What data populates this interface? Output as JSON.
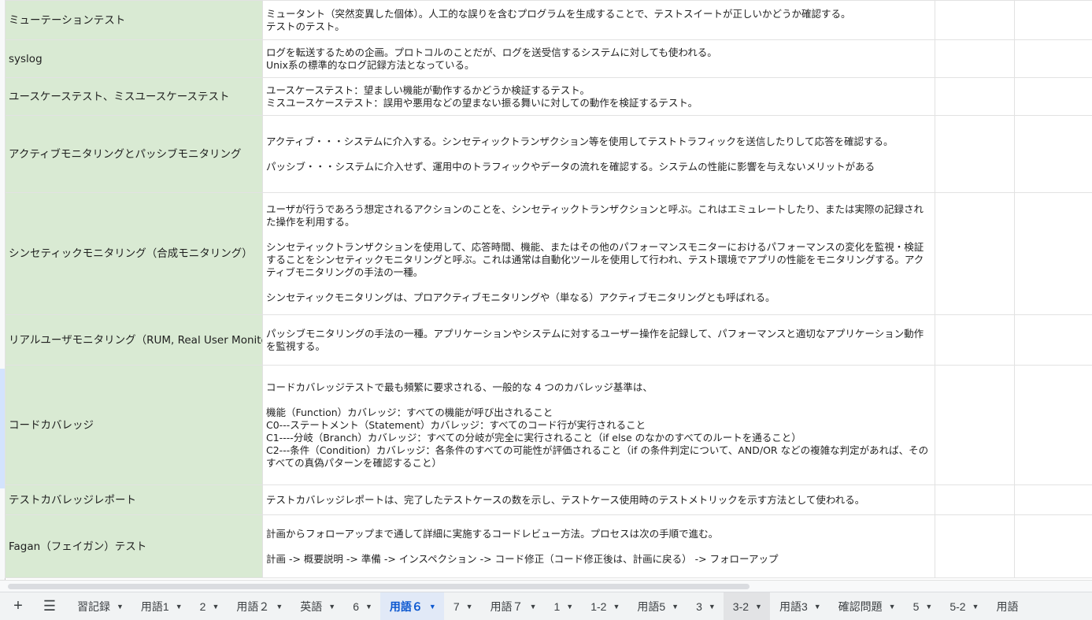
{
  "rows": [
    {
      "term": "ミューテーションテスト",
      "desc": [
        "ミュータント（突然変異した個体）。人工的な誤りを含むプログラムを生成することで、テストスイートが正しいかどうか確認する。",
        "テストのテスト。"
      ]
    },
    {
      "term": "syslog",
      "desc": [
        "ログを転送するための企画。プロトコルのことだが、ログを送受信するシステムに対しても使われる。",
        "Unix系の標準的なログ記録方法となっている。"
      ]
    },
    {
      "term": "ユースケーステスト、ミスユースケーステスト",
      "desc": [
        "ユースケーステスト：望ましい機能が動作するかどうか検証するテスト。",
        "ミスユースケーステスト：誤用や悪用などの望まない振る舞いに対しての動作を検証するテスト。"
      ]
    },
    {
      "term": "アクティブモニタリングとパッシブモニタリング",
      "desc": [
        "アクティブ・・・システムに介入する。シンセティックトランザクション等を使用してテストトラフィックを送信したりして応答を確認する。",
        "",
        "パッシブ・・・システムに介入せず、運用中のトラフィックやデータの流れを確認する。システムの性能に影響を与えないメリットがある"
      ]
    },
    {
      "term": "シンセティックモニタリング（合成モニタリング）",
      "desc": [
        "ユーザが行うであろう想定されるアクションのことを、シンセティックトランザクションと呼ぶ。これはエミュレートしたり、または実際の記録された操作を利用する。",
        "",
        "シンセティックトランザクションを使用して、応答時間、機能、またはその他のパフォーマンスモニターにおけるパフォーマンスの変化を監視・検証することをシンセティックモニタリングと呼ぶ。これは通常は自動化ツールを使用して行われ、テスト環境でアプリの性能をモニタリングする。アクティブモニタリングの手法の一種。",
        "",
        "シンセティックモニタリングは、プロアクティブモニタリングや（単なる）アクティブモニタリングとも呼ばれる。"
      ]
    },
    {
      "term": "リアルユーザモニタリング（RUM, Real User Monitoring）",
      "desc": [
        "パッシブモニタリングの手法の一種。アプリケーションやシステムに対するユーザー操作を記録して、パフォーマンスと適切なアプリケーション動作を監視する。"
      ]
    },
    {
      "term": "コードカバレッジ",
      "desc": [
        "コードカバレッジテストで最も頻繁に要求される、一般的な 4 つのカバレッジ基準は、",
        "",
        "機能（Function）カバレッジ：すべての機能が呼び出されること",
        "C0---ステートメント（Statement）カバレッジ：すべてのコード行が実行されること",
        "C1----分岐（Branch）カバレッジ：すべての分岐が完全に実行されること（if else のなかのすべてのルートを通ること）",
        "C2---条件（Condition）カバレッジ：各条件のすべての可能性が評価されること（if の条件判定について、AND/OR などの複雑な判定があれば、そのすべての真偽パターンを確認すること）"
      ]
    },
    {
      "term": "テストカバレッジレポート",
      "desc": [
        "テストカバレッジレポートは、完了したテストケースの数を示し、テストケース使用時のテストメトリックを示す方法として使われる。"
      ]
    },
    {
      "term": "Fagan（フェイガン）テスト",
      "desc": [
        "計画からフォローアップまで通して詳細に実施するコードレビュー方法。プロセスは次の手順で進む。",
        "",
        "計画 -> 概要説明 -> 準備 -> インスペクション -> コード修正（コード修正後は、計画に戻る） -> フォローアップ"
      ]
    }
  ],
  "tabbar": {
    "add_icon": "plus-icon",
    "menu_icon": "hamburger-menu-icon",
    "tabs": [
      "習記録",
      "用語1",
      "2",
      "用語２",
      "英語",
      "6",
      "用語６",
      "7",
      "用語７",
      "1",
      "1-2",
      "用語5",
      "3",
      "3-2",
      "用語3",
      "確認問題",
      "5",
      "5-2",
      "用語"
    ],
    "active_index": 6,
    "hover_index": 13
  }
}
